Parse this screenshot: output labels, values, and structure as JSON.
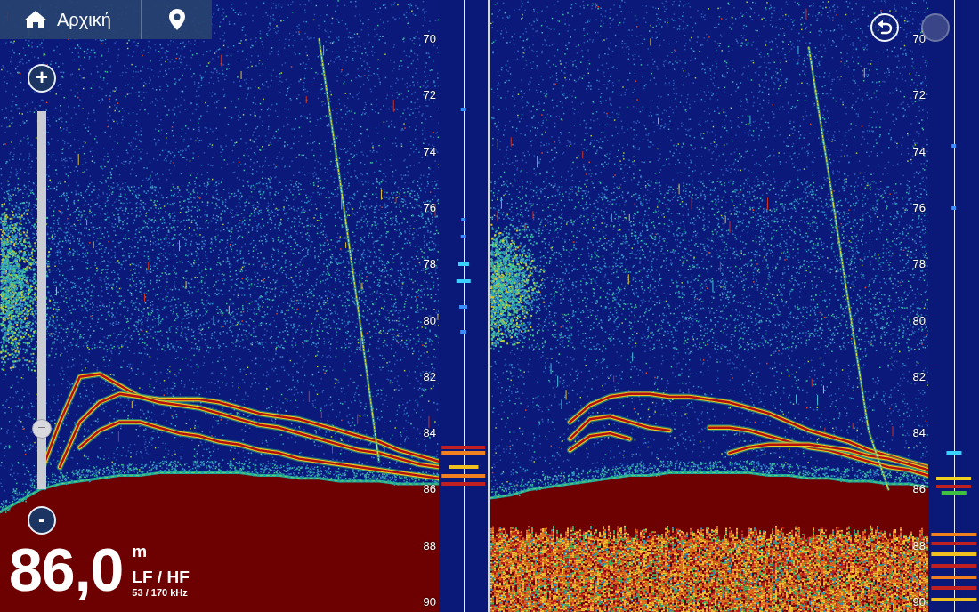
{
  "toolbar": {
    "home_label": "Αρχική"
  },
  "zoom": {
    "plus": "+",
    "minus": "-",
    "level": 0.16
  },
  "readout": {
    "depth": "86,0",
    "unit": "m",
    "mode": "LF / HF",
    "frequency": "53 / 170 kHz"
  },
  "controls": {
    "undo": {
      "disabled": false
    },
    "redo": {
      "disabled": true
    }
  },
  "panels": [
    {
      "scale": [
        "70",
        "72",
        "74",
        "76",
        "78",
        "80",
        "82",
        "84",
        "86",
        "88",
        "90"
      ],
      "school": {
        "from": 75.5,
        "to": 82.0
      },
      "subbottom": null,
      "bottom": [
        86.8,
        86.4,
        86.0,
        85.8,
        85.7,
        85.6,
        85.5,
        85.5,
        85.4,
        85.4,
        85.4,
        85.4,
        85.4,
        85.5,
        85.5,
        85.6,
        85.6,
        85.7,
        85.7,
        85.7,
        85.8,
        85.8,
        85.8
      ],
      "traces": [
        {
          "kind": "echo",
          "values": [
            null,
            null,
            85.5,
            83.6,
            82.0,
            81.9,
            82.3,
            82.7,
            82.8,
            82.8,
            82.8,
            82.9,
            83.1,
            83.3,
            83.4,
            83.5,
            83.7,
            83.9,
            84.1,
            84.3,
            84.6,
            84.8,
            85.0
          ]
        },
        {
          "kind": "echo",
          "values": [
            null,
            null,
            null,
            85.2,
            83.6,
            82.9,
            82.6,
            82.7,
            82.9,
            83.0,
            83.1,
            83.3,
            83.5,
            83.7,
            83.8,
            84.0,
            84.2,
            84.4,
            84.6,
            84.7,
            84.9,
            85.1,
            85.2
          ]
        },
        {
          "kind": "echo",
          "values": [
            null,
            null,
            null,
            null,
            84.5,
            83.9,
            83.6,
            83.6,
            83.8,
            84.0,
            84.1,
            84.3,
            84.4,
            84.6,
            84.7,
            84.9,
            85.0,
            85.1,
            85.2,
            85.3,
            85.4,
            85.5,
            85.6
          ]
        },
        {
          "kind": "lure",
          "values": [
            null,
            null,
            null,
            null,
            null,
            null,
            null,
            null,
            null,
            null,
            null,
            null,
            null,
            null,
            null,
            null,
            70.0,
            74.8,
            79.8,
            85.0,
            null,
            null,
            null
          ]
        }
      ],
      "ascope": [
        {
          "depth": 72.5,
          "color": "#3a8cff",
          "level": 0.12
        },
        {
          "depth": 76.4,
          "color": "#3a8cff",
          "level": 0.1
        },
        {
          "depth": 77.0,
          "color": "#3a8cff",
          "level": 0.12
        },
        {
          "depth": 78.0,
          "color": "#3ad0ff",
          "level": 0.22
        },
        {
          "depth": 78.6,
          "color": "#3ad0ff",
          "level": 0.3
        },
        {
          "depth": 79.5,
          "color": "#3a8cff",
          "level": 0.18
        },
        {
          "depth": 80.4,
          "color": "#3a8cff",
          "level": 0.14
        },
        {
          "depth": 84.5,
          "color": "#c02020",
          "level": 0.9
        },
        {
          "depth": 84.7,
          "color": "#f08020",
          "level": 0.9
        },
        {
          "depth": 85.2,
          "color": "#f0c020",
          "level": 0.6
        },
        {
          "depth": 85.5,
          "color": "#f08020",
          "level": 0.9
        },
        {
          "depth": 85.8,
          "color": "#c02020",
          "level": 0.9
        }
      ]
    },
    {
      "scale": [
        "70",
        "72",
        "74",
        "76",
        "78",
        "80",
        "82",
        "84",
        "86",
        "88",
        "90"
      ],
      "school": {
        "from": 76.5,
        "to": 81.0
      },
      "subbottom": 87.4,
      "bottom": [
        86.3,
        86.2,
        86.0,
        85.9,
        85.8,
        85.7,
        85.6,
        85.5,
        85.5,
        85.4,
        85.4,
        85.4,
        85.4,
        85.4,
        85.5,
        85.5,
        85.6,
        85.6,
        85.7,
        85.7,
        85.8,
        85.8,
        85.9
      ],
      "traces": [
        {
          "kind": "echo",
          "values": [
            null,
            null,
            null,
            null,
            83.6,
            83.0,
            82.7,
            82.6,
            82.6,
            82.7,
            82.7,
            82.8,
            82.9,
            83.1,
            83.3,
            83.6,
            83.9,
            84.1,
            84.3,
            84.6,
            84.8,
            85.0,
            85.2
          ]
        },
        {
          "kind": "echo",
          "values": [
            null,
            null,
            null,
            null,
            84.2,
            83.5,
            83.4,
            83.6,
            83.8,
            83.9,
            null,
            83.8,
            83.8,
            83.9,
            84.1,
            84.3,
            84.5,
            84.6,
            84.8,
            85.0,
            85.2,
            85.3,
            85.5
          ]
        },
        {
          "kind": "echo",
          "values": [
            null,
            null,
            null,
            null,
            84.6,
            84.1,
            84.0,
            84.2,
            null,
            null,
            null,
            null,
            null,
            null,
            null,
            null,
            null,
            null,
            null,
            null,
            null,
            null,
            null
          ]
        },
        {
          "kind": "echo",
          "values": [
            null,
            null,
            null,
            null,
            null,
            null,
            null,
            null,
            null,
            null,
            null,
            null,
            84.7,
            84.5,
            84.4,
            84.4,
            84.4,
            84.5,
            84.6,
            84.8,
            84.9,
            85.1,
            85.3
          ]
        },
        {
          "kind": "lure",
          "values": [
            null,
            null,
            null,
            null,
            null,
            null,
            null,
            null,
            null,
            null,
            null,
            null,
            null,
            null,
            null,
            null,
            70.3,
            74.8,
            79.4,
            83.9,
            86.0,
            null,
            null
          ]
        }
      ],
      "ascope": [
        {
          "depth": 73.8,
          "color": "#3a8cff",
          "level": 0.1
        },
        {
          "depth": 76.0,
          "color": "#3a8cff",
          "level": 0.1
        },
        {
          "depth": 84.7,
          "color": "#3ad0ff",
          "level": 0.3
        },
        {
          "depth": 85.6,
          "color": "#f0d020",
          "level": 0.7
        },
        {
          "depth": 85.9,
          "color": "#c02020",
          "level": 0.7
        },
        {
          "depth": 86.1,
          "color": "#40c040",
          "level": 0.5
        },
        {
          "depth": 87.6,
          "color": "#f08020",
          "level": 0.9
        },
        {
          "depth": 87.9,
          "color": "#c02020",
          "level": 0.9
        },
        {
          "depth": 88.3,
          "color": "#f0c020",
          "level": 0.9
        },
        {
          "depth": 88.7,
          "color": "#c02020",
          "level": 0.9
        },
        {
          "depth": 89.1,
          "color": "#f08020",
          "level": 0.9
        },
        {
          "depth": 89.5,
          "color": "#c02020",
          "level": 0.9
        },
        {
          "depth": 89.9,
          "color": "#f0c020",
          "level": 0.9
        }
      ]
    }
  ]
}
